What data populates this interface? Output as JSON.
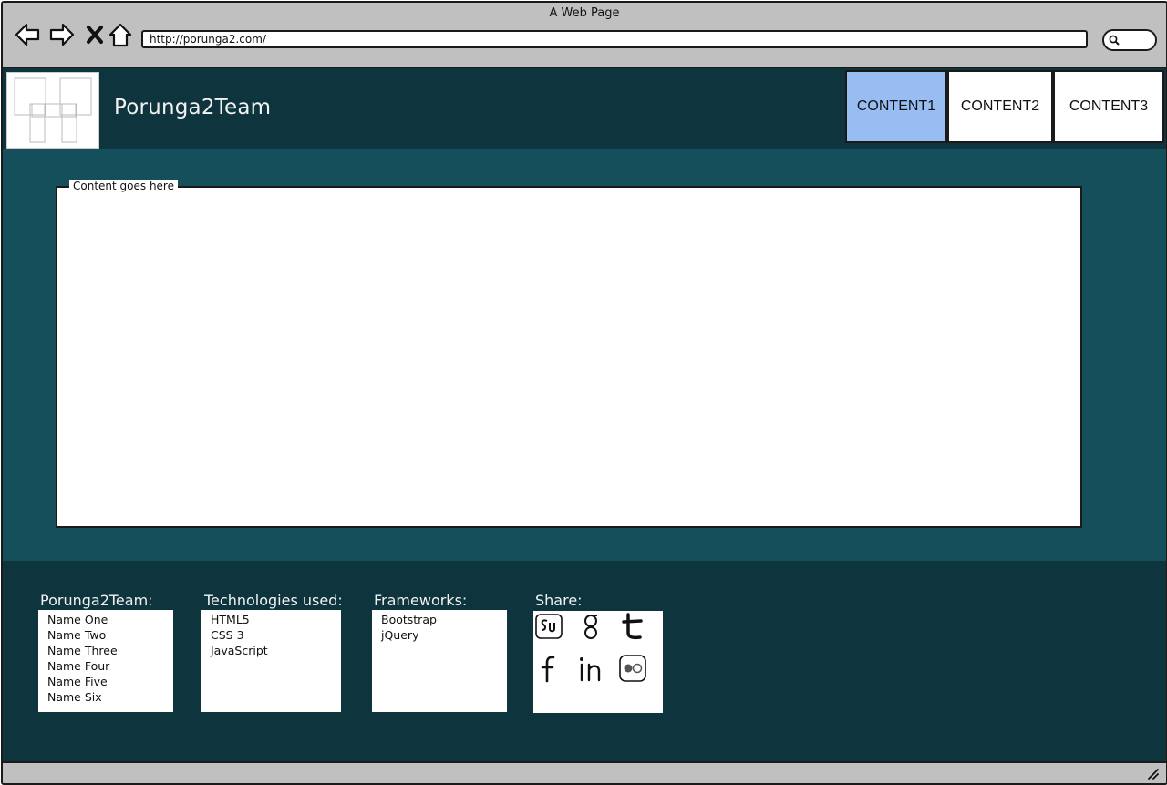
{
  "window": {
    "title": "A Web Page"
  },
  "browser": {
    "url": "http://porunga2.com/",
    "nav_icons": [
      "back-arrow-icon",
      "forward-arrow-icon",
      "close-icon",
      "home-icon"
    ],
    "search_icon": "search-icon"
  },
  "header": {
    "site_title": "Porunga2Team",
    "tabs": [
      {
        "label": "CONTENT1",
        "active": true
      },
      {
        "label": "CONTENT2",
        "active": false
      },
      {
        "label": "CONTENT3",
        "active": false
      }
    ]
  },
  "main": {
    "panel_label": "Content goes here"
  },
  "footer": {
    "team": {
      "title": "Porunga2Team:",
      "items": [
        "Name One",
        "Name Two",
        "Name Three",
        "Name Four",
        "Name Five",
        "Name Six"
      ]
    },
    "technologies": {
      "title": "Technologies used:",
      "items": [
        "HTML5",
        "CSS 3",
        "JavaScript"
      ]
    },
    "frameworks": {
      "title": "Frameworks:",
      "items": [
        "Bootstrap",
        "jQuery"
      ]
    },
    "share": {
      "title": "Share:",
      "icons": [
        "stumbleupon-icon",
        "google-icon",
        "twitter-icon",
        "facebook-icon",
        "linkedin-icon",
        "flickr-icon"
      ]
    }
  },
  "colors": {
    "chrome": "#c0c0c0",
    "header_bg": "#0e343e",
    "main_bg": "#154f5c",
    "footer_bg": "#0e343e",
    "active_tab": "#97bdf3"
  }
}
